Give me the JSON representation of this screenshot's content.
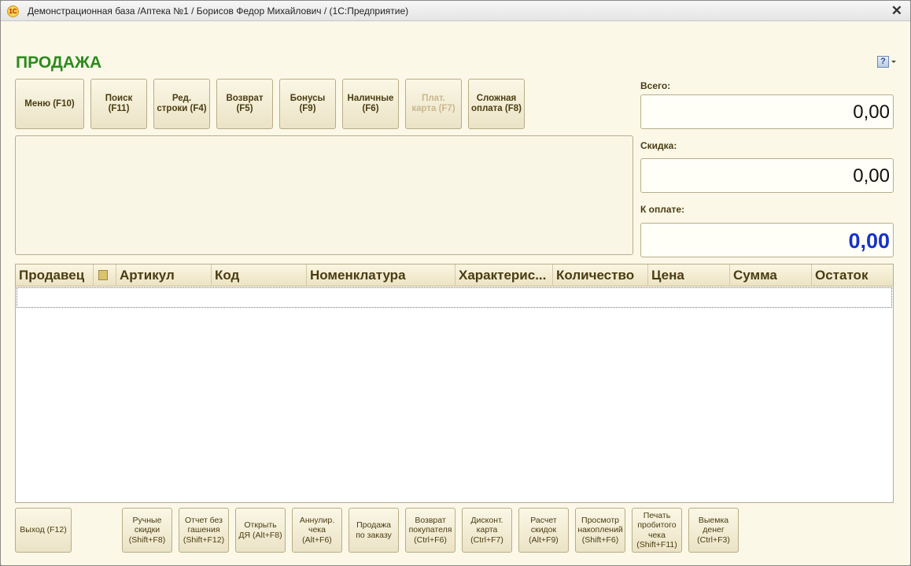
{
  "window": {
    "title": "Демонстрационная база /Аптека №1 / Борисов Федор Михайлович /  (1С:Предприятие)",
    "logo_text": "1С",
    "close_glyph": "✕"
  },
  "page": {
    "title": "ПРОДАЖА",
    "help_glyph": "?"
  },
  "toolbar": {
    "menu": "Меню (F10)",
    "search": "Поиск\n(F11)",
    "edit_row": "Ред.\nстроки (F4)",
    "return": "Возврат\n(F5)",
    "bonuses": "Бонусы\n(F9)",
    "cash": "Наличные\n(F6)",
    "card": "Плат.\nкарта (F7)",
    "complex_payment": "Сложная\nоплата (F8)"
  },
  "totals": {
    "total_label": "Всего:",
    "total_value": "0,00",
    "discount_label": "Скидка:",
    "discount_value": "0,00",
    "to_pay_label": "К оплате:",
    "to_pay_value": "0,00"
  },
  "grid": {
    "columns": [
      "Продавец",
      "",
      "Артикул",
      "Код",
      "Номенклатура",
      "Характерис...",
      "Количество",
      "Цена",
      "Сумма",
      "Остаток"
    ],
    "rows": []
  },
  "bottom": {
    "exit": "Выход (F12)",
    "manual_discounts": "Ручные\nскидки\n(Shift+F8)",
    "report_no_clear": "Отчет без\nгашения\n(Shift+F12)",
    "open_cash_drawer": "Открыть\nДЯ (Alt+F8)",
    "cancel_receipt": "Аннулир.\nчека\n(Alt+F6)",
    "sale_by_order": "Продажа\nпо заказу",
    "customer_return": "Возврат\nпокупателя\n(Ctrl+F6)",
    "discount_card": "Дисконт.\nкарта\n(Ctrl+F7)",
    "calc_discounts": "Расчет\nскидок\n(Alt+F9)",
    "view_accumulations": "Просмотр\nнакоплений\n(Shift+F6)",
    "print_receipt": "Печать\nпробитого\nчека\n(Shift+F11)",
    "cash_withdrawal": "Выемка\nденег\n(Ctrl+F3)"
  }
}
